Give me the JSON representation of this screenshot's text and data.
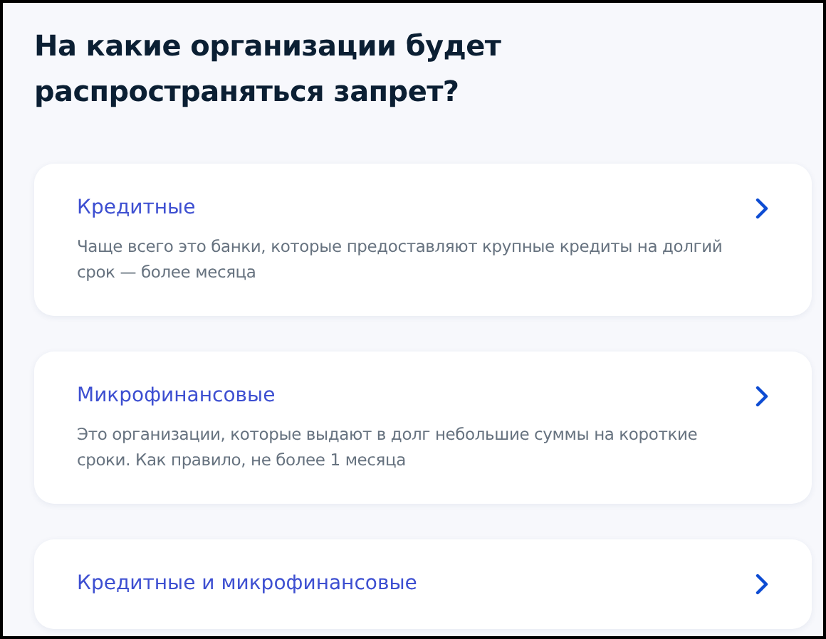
{
  "heading": "На какие организации будет распространяться запрет?",
  "options": [
    {
      "title": "Кредитные",
      "description": "Чаще всего это банки, которые предоставляют крупные кредиты на долгий срок — более месяца"
    },
    {
      "title": "Микрофинансовые",
      "description": "Это организации, которые выдают в долг небольшие суммы на короткие сроки. Как правило, не более 1 месяца"
    },
    {
      "title": "Кредитные и микрофинансовые"
    }
  ]
}
